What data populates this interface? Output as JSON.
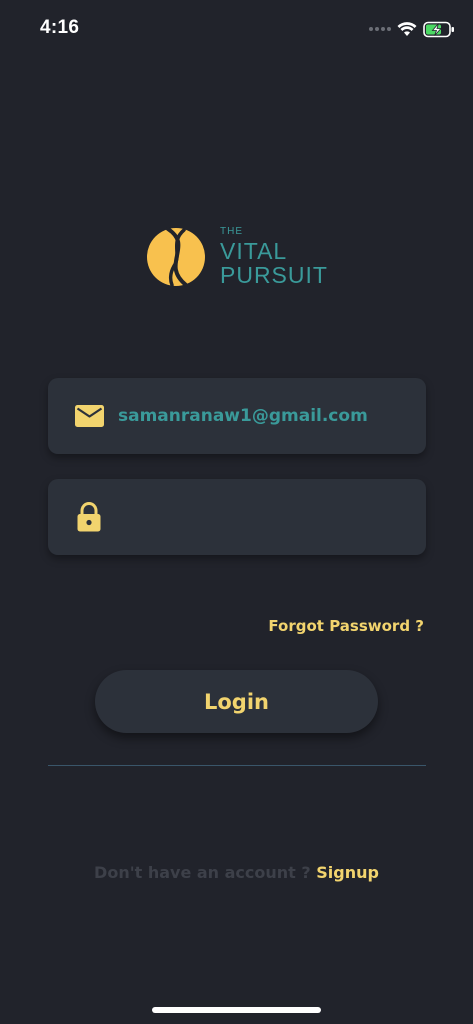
{
  "status_bar": {
    "time": "4:16",
    "icons": [
      "signal-dots-icon",
      "wifi-icon",
      "battery-charging-icon"
    ]
  },
  "logo": {
    "line1": "THE",
    "line2": "VITAL",
    "line3": "PURSUIT",
    "mark_color": "#f8c14e",
    "text_color": "#3a9a9a"
  },
  "form": {
    "email": {
      "value": "samanranaw1@gmail.com",
      "icon": "envelope-icon"
    },
    "password": {
      "value": "",
      "icon": "lock-icon"
    },
    "forgot_label": "Forgot Password ?",
    "login_label": "Login"
  },
  "footer": {
    "prompt": "Don't have an account ?",
    "signup_label": "Signup"
  },
  "colors": {
    "background": "#21232b",
    "surface": "#2c313a",
    "accent": "#f2d46e",
    "teal": "#3a9a9a"
  }
}
